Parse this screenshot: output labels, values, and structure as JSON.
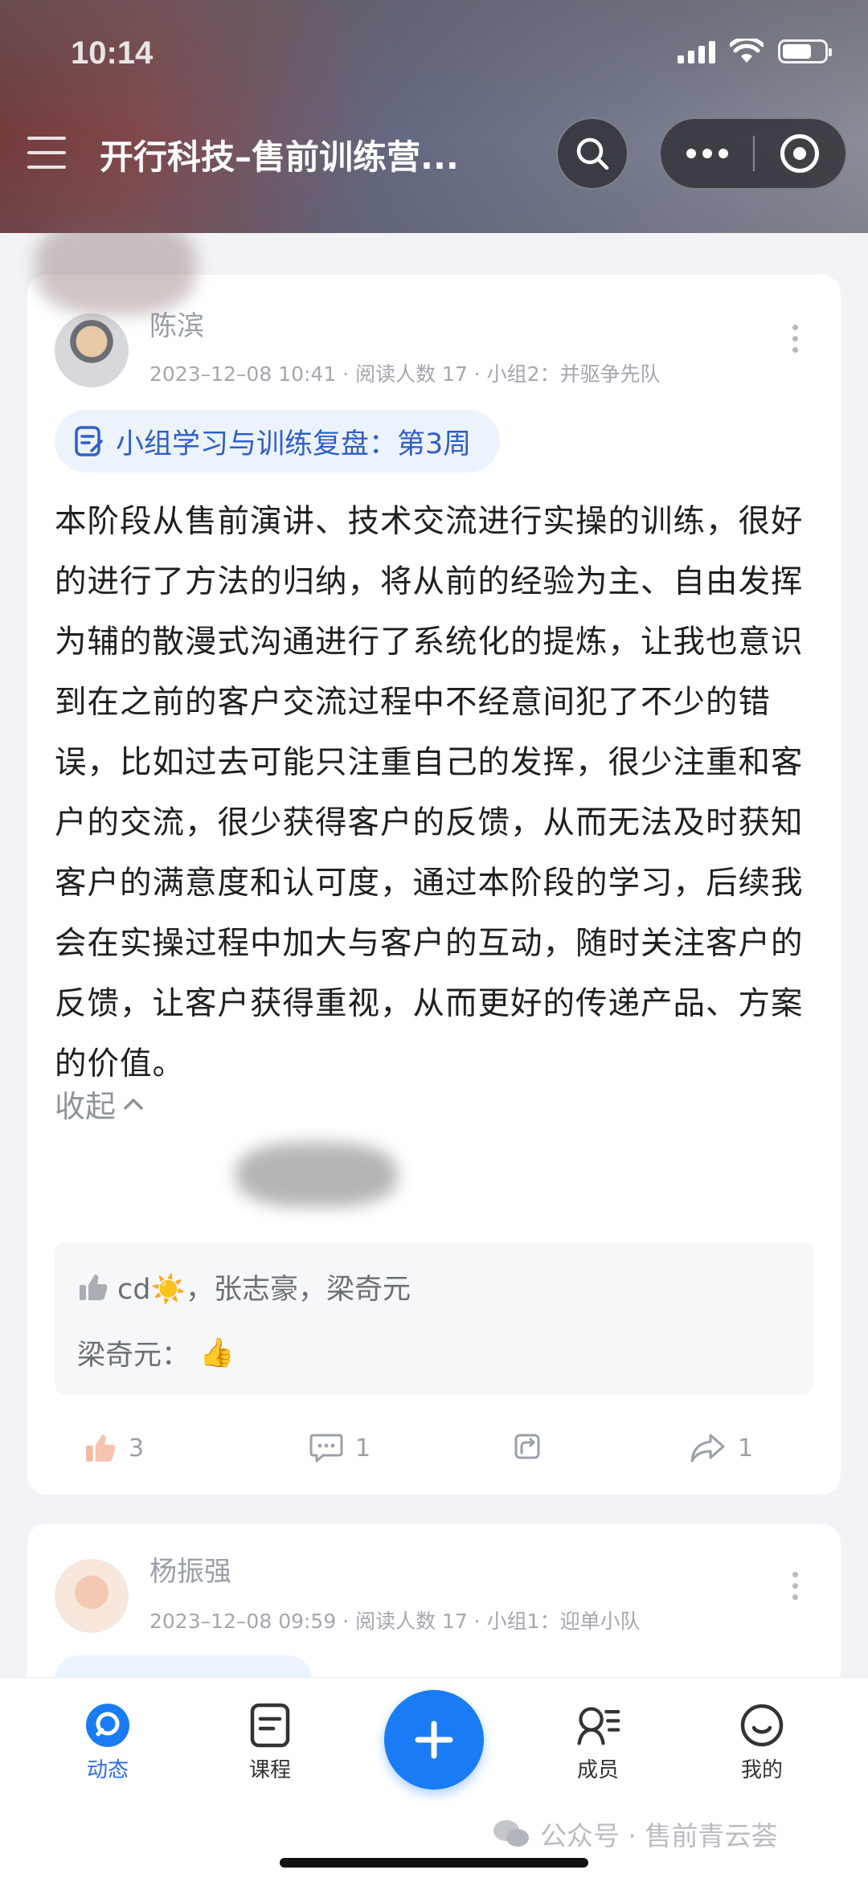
{
  "status_bar": {
    "time": "10:14"
  },
  "header": {
    "title": "开行科技–售前训练营..."
  },
  "posts": [
    {
      "author": "陈滨",
      "meta": "2023–12–08 10:41 · 阅读人数 17 · 小组2：并驱争先队",
      "tag": "小组学习与训练复盘：第3周",
      "content": "本阶段从售前演讲、技术交流进行实操的训练，很好的进行了方法的归纳，将从前的经验为主、自由发挥为辅的散漫式沟通进行了系统化的提炼，让我也意识到在之前的客户交流过程中不经意间犯了不少的错误，比如过去可能只注重自己的发挥，很少注重和客户的交流，很少获得客户的反馈，从而无法及时获知客户的满意度和认可度，通过本阶段的学习，后续我会在实操过程中加大与客户的互动，随时关注客户的反馈，让客户获得重视，从而更好的传递产品、方案的价值。",
      "collapse_label": "收起",
      "likes_text": "cd☀️，张志豪，梁奇元",
      "comment_author": "梁奇元：",
      "comment_emoji": "👍",
      "like_count": "3",
      "comment_count": "1",
      "share_count": "1"
    },
    {
      "author": "杨振强",
      "meta": "2023–12–08 09:59 · 阅读人数 17 · 小组1：迎单小队"
    }
  ],
  "tabbar": {
    "tabs": [
      {
        "label": "动态",
        "icon": "feed-icon",
        "active": true
      },
      {
        "label": "课程",
        "icon": "course-icon"
      },
      {
        "label": "成员",
        "icon": "members-icon"
      },
      {
        "label": "我的",
        "icon": "profile-icon"
      }
    ],
    "fab_icon": "plus-icon"
  },
  "watermark": "公众号 · 售前青云荟",
  "colors": {
    "accent": "#1a7cf5",
    "tag_text": "#2f5fc9",
    "tag_bg": "#edf3fd"
  }
}
